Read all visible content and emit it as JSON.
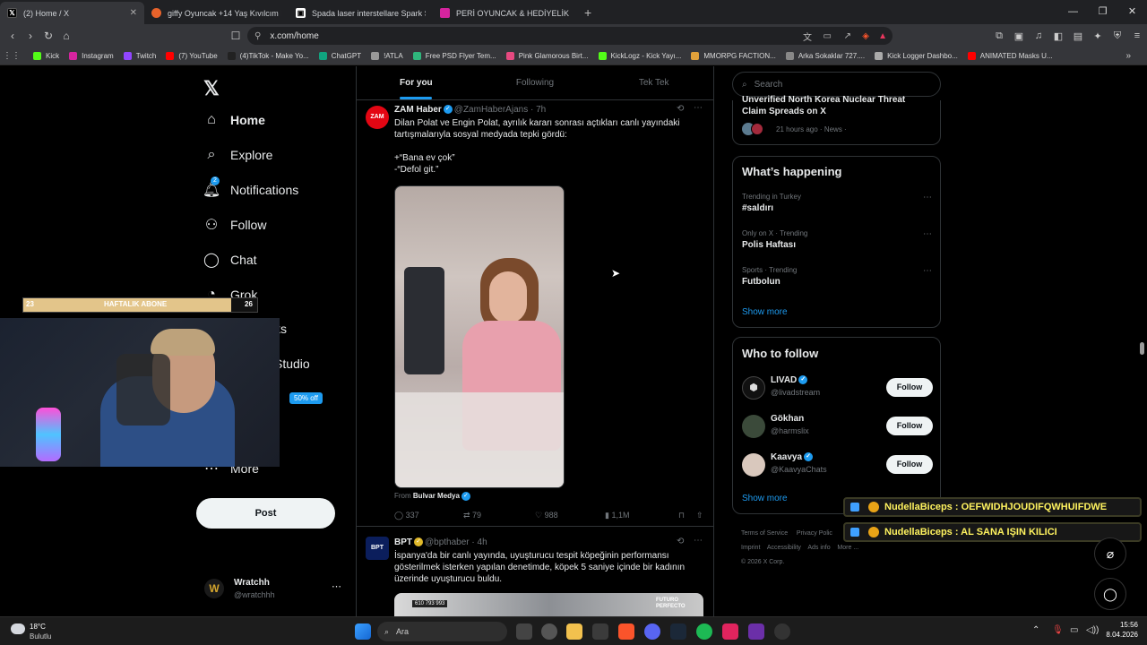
{
  "browser": {
    "tabs": [
      {
        "title": "(2) Home / X",
        "active": true,
        "icon": "x-logo-icon",
        "color": "#000000"
      },
      {
        "title": "giffy Oyuncak +14 Yaş Kıvılcım Efekt",
        "active": false,
        "icon": "giffy-icon",
        "color": "#e8632b"
      },
      {
        "title": "Spada laser interstellare Spark Sparkl",
        "active": false,
        "icon": "spada-icon",
        "color": "#ffffff"
      },
      {
        "title": "PERİ OYUNCAK & HEDİYELİK (@peri",
        "active": false,
        "icon": "instagram-icon",
        "color": "#d6249f"
      }
    ],
    "url": "x.com/home",
    "bookmarks": [
      {
        "label": "Kick",
        "color": "#53fc18"
      },
      {
        "label": "Instagram",
        "color": "#d6249f"
      },
      {
        "label": "Twitch",
        "color": "#9146ff"
      },
      {
        "label": "(7) YouTube",
        "color": "#ff0000"
      },
      {
        "label": "(4)TikTok - Make Yo...",
        "color": "#222222"
      },
      {
        "label": "ChatGPT",
        "color": "#10a37f"
      },
      {
        "label": "!ATLA",
        "color": "#999999"
      },
      {
        "label": "Free PSD Flyer Tem...",
        "color": "#2fb67c"
      },
      {
        "label": "Pink Glamorous Birt...",
        "color": "#e64980"
      },
      {
        "label": "KickLogz - Kick Yayı...",
        "color": "#53fc18"
      },
      {
        "label": "MMORPG FACTION...",
        "color": "#e0a03a"
      },
      {
        "label": "Arka Sokaklar 727....",
        "color": "#888888"
      },
      {
        "label": "Kick Logger Dashbo...",
        "color": "#aaaaaa"
      },
      {
        "label": "ANIMATED Masks U...",
        "color": "#ff0000"
      }
    ]
  },
  "sidebar": {
    "items": [
      {
        "label": "Home",
        "icon": "home-icon"
      },
      {
        "label": "Explore",
        "icon": "search-icon"
      },
      {
        "label": "Notifications",
        "icon": "bell-icon",
        "badge": "2"
      },
      {
        "label": "Follow",
        "icon": "person-add-icon"
      },
      {
        "label": "Chat",
        "icon": "chat-icon"
      },
      {
        "label": "Grok",
        "icon": "grok-icon"
      },
      {
        "label": "ks",
        "icon": "bookmarks-icon"
      },
      {
        "label": "Studio",
        "icon": "studio-icon"
      },
      {
        "label": "More",
        "icon": "more-icon"
      }
    ],
    "premium_badge": "50% off",
    "post_button": "Post",
    "account": {
      "name": "Wratchh",
      "handle": "@wratchhh"
    }
  },
  "overlay": {
    "sub_goal_left": "23",
    "sub_goal_label": "HAFTALIK ABONE",
    "sub_goal_right": "26",
    "chat_1": "NudellaBiceps : OEFWIDHJOUDIFQWHUIFDWE",
    "chat_2": "NudellaBiceps : AL SANA IŞIN KILICI"
  },
  "feed": {
    "tabs": [
      "For you",
      "Following",
      "Tek Tek"
    ],
    "tweets": [
      {
        "author": "ZAM Haber",
        "handle": "@ZamHaberAjans",
        "time": "· 7h",
        "avatar_text": "ZAM",
        "text": "Dilan Polat ve Engin Polat, ayrılık kararı sonrası açtıkları canlı yayındaki tartışmalarıyla sosyal medyada tepki gördü:",
        "quote_1": "+“Bana ev çok”",
        "quote_2": "-“Defol git.”",
        "from_label": "From",
        "from_source": "Bulvar Medya",
        "replies": "337",
        "retweets": "79",
        "likes": "988",
        "views": "1,1M"
      },
      {
        "author": "BPT",
        "handle": "@bpthaber",
        "time": "· 4h",
        "avatar_text": "BPT",
        "text": "İspanya'da bir canlı yayında, uyuşturucu tespit köpeğinin performansı gösterilmek isterken yapılan denetimde, köpek 5 saniye içinde bir kadının üzerinde uyuşturucu buldu.",
        "media_caption": "FUTURO PERFECTO",
        "media_phone": "610 793 993"
      }
    ]
  },
  "right": {
    "search_placeholder": "Search",
    "news": {
      "title_line1": "Unverified North Korea Nuclear Threat",
      "title_line2": "Claim Spreads on X",
      "meta": "21 hours ago · News ·"
    },
    "happening": {
      "title": "What’s happening",
      "trends": [
        {
          "meta": "Trending in Turkey",
          "title": "#saldırı"
        },
        {
          "meta": "Only on X · Trending",
          "title": "Polis Haftası"
        },
        {
          "meta": "Sports · Trending",
          "title": "Futbolun"
        }
      ],
      "show_more": "Show more"
    },
    "who_to_follow": {
      "title": "Who to follow",
      "accounts": [
        {
          "name": "LIVAD",
          "handle": "@livadstream",
          "verified": true
        },
        {
          "name": "Gökhan",
          "handle": "@harmslix",
          "verified": false
        },
        {
          "name": "Kaavya",
          "handle": "@KaavyaChats",
          "verified": true
        }
      ],
      "follow_label": "Follow",
      "show_more": "Show more"
    },
    "footer": {
      "line1": [
        "Terms of Service",
        "Privacy Polic"
      ],
      "line2": [
        "Imprint",
        "Accessibility",
        "Ads info",
        "More ..."
      ],
      "copyright": "© 2026 X Corp."
    }
  },
  "taskbar": {
    "weather_temp": "18°C",
    "weather_desc": "Bulutlu",
    "search_label": "Ara",
    "time": "15:56",
    "date": "8.04.2026"
  }
}
